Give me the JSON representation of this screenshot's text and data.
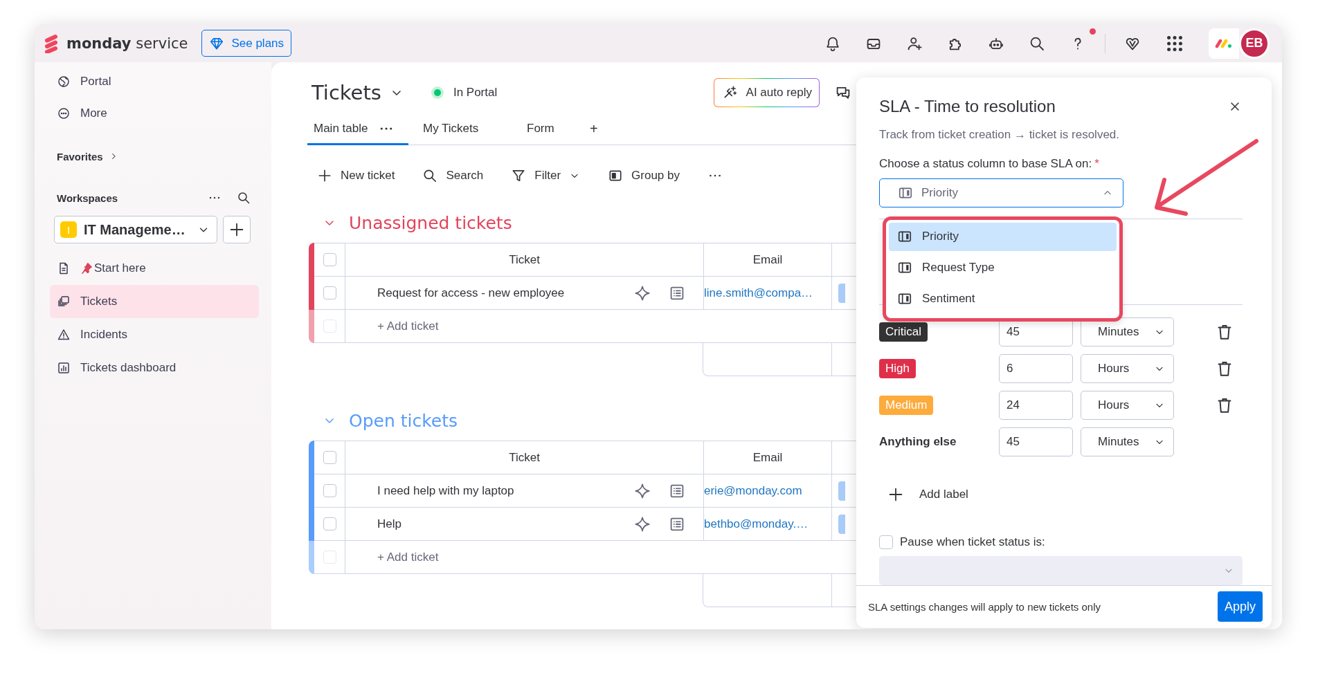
{
  "topbar": {
    "brand": "monday",
    "product": "service",
    "plans_button": "See plans",
    "help_notification": true,
    "avatar": "EB"
  },
  "sidebar": {
    "items": [
      {
        "label": "Portal",
        "selected": false
      },
      {
        "label": "More",
        "selected": false
      }
    ],
    "favorites": "Favorites",
    "workspaces_heading": "Workspaces",
    "workspace": {
      "badge": "I",
      "name": "IT Manageme…"
    },
    "boards": [
      {
        "label": "Start here",
        "selected": false
      },
      {
        "label": "Tickets",
        "selected": true
      },
      {
        "label": "Incidents",
        "selected": false
      },
      {
        "label": "Tickets dashboard",
        "selected": false
      }
    ]
  },
  "board": {
    "title": "Tickets",
    "status": "In Portal",
    "tabs": [
      {
        "label": "Main table",
        "selected": true
      },
      {
        "label": "My Tickets",
        "selected": false
      },
      {
        "label": "Form",
        "selected": false
      }
    ],
    "add_tab": "+",
    "ai_button": "AI auto reply",
    "toolbar": [
      "New ticket",
      "Search",
      "Filter",
      "Group by"
    ],
    "groups": [
      {
        "title": "Unassigned tickets",
        "color": "#e2445c",
        "all_checked": false,
        "add_checkbox_disabled": true,
        "columns": [
          "Ticket",
          "Email"
        ],
        "rows": [
          {
            "ticket": "Request for access - new employee",
            "email": "line.smith@compa…",
            "checked": false
          }
        ],
        "add_row": "+ Add ticket"
      },
      {
        "title": "Open tickets",
        "color": "#579bfc",
        "all_checked": false,
        "add_checkbox_disabled": true,
        "columns": [
          "Ticket",
          "Email"
        ],
        "rows": [
          {
            "ticket": "I need help with my laptop",
            "email": "erie@monday.com",
            "checked": false
          },
          {
            "ticket": "Help",
            "email": "bethbo@monday.…",
            "checked": false
          }
        ],
        "add_row": "+ Add ticket"
      }
    ]
  },
  "sla_panel": {
    "title": "SLA - Time to resolution",
    "subtitle": "Track from ticket creation → ticket is resolved.",
    "field_label": "Choose a status column to base SLA on:",
    "required_mark": "*",
    "select": {
      "value": "Priority",
      "expanded": true
    },
    "options": [
      {
        "label": "Priority",
        "selected": true
      },
      {
        "label": "Request Type",
        "selected": false
      },
      {
        "label": "Sentiment",
        "selected": false
      }
    ],
    "rules": [
      {
        "label": "Critical",
        "kind": "tag",
        "color": "#333333",
        "amount": "45",
        "unit": "Minutes"
      },
      {
        "label": "High",
        "kind": "tag",
        "color": "#df2f4a",
        "amount": "6",
        "unit": "Hours"
      },
      {
        "label": "Medium",
        "kind": "tag",
        "color": "#fdab3d",
        "amount": "24",
        "unit": "Hours"
      },
      {
        "label": "Anything else",
        "kind": "plain",
        "amount": "45",
        "unit": "Minutes"
      }
    ],
    "add_label": "Add label",
    "pause": {
      "label": "Pause when ticket status is:",
      "checked": false
    },
    "footer_note": "SLA settings changes will apply to new tickets only",
    "apply_button": "Apply"
  }
}
